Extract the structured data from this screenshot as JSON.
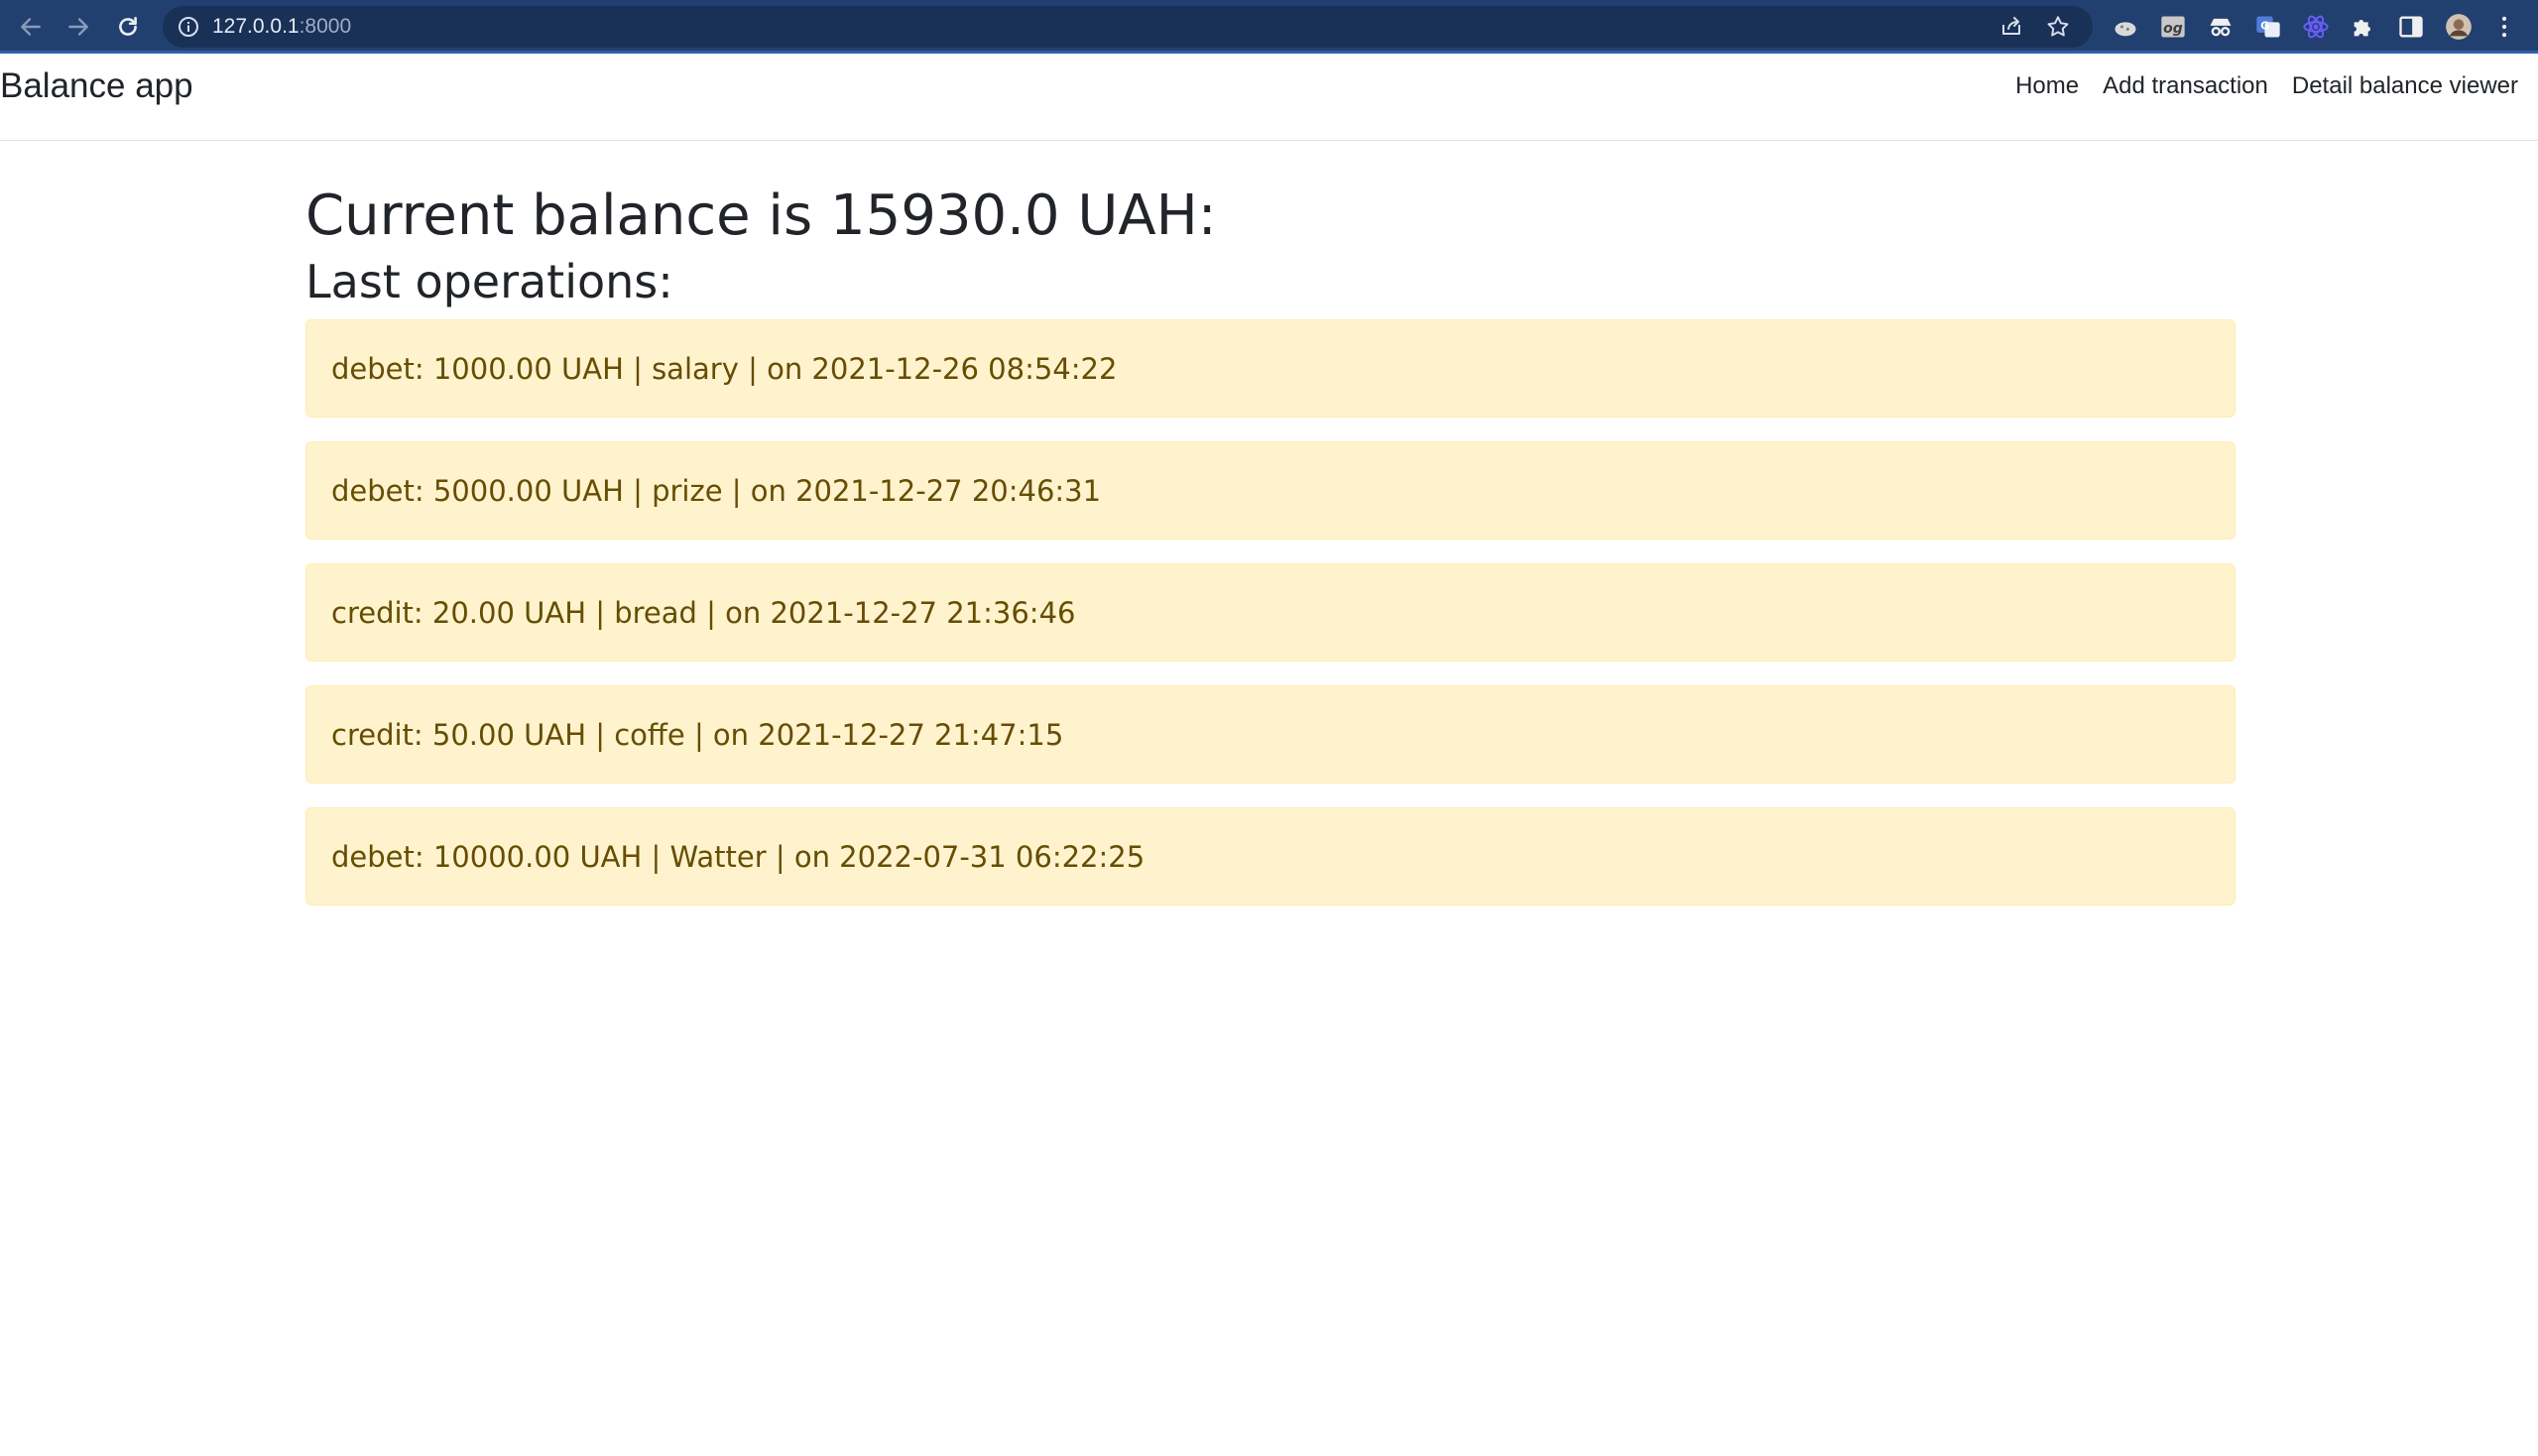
{
  "browser": {
    "url_host": "127.0.0.1",
    "url_port": ":8000"
  },
  "navbar": {
    "brand": "Balance app",
    "links": [
      {
        "label": "Home"
      },
      {
        "label": "Add transaction"
      },
      {
        "label": "Detail balance viewer"
      }
    ]
  },
  "main": {
    "balance_heading": "Current balance is 15930.0 UAH:",
    "operations_heading": "Last operations:",
    "operations": [
      {
        "text": "debet: 1000.00 UAH | salary | on 2021-12-26 08:54:22"
      },
      {
        "text": "debet: 5000.00 UAH | prize | on 2021-12-27 20:46:31"
      },
      {
        "text": "credit: 20.00 UAH | bread | on 2021-12-27 21:36:46"
      },
      {
        "text": "credit: 50.00 UAH | coffe | on 2021-12-27 21:47:15"
      },
      {
        "text": "debet: 10000.00 UAH | Watter | on 2022-07-31 06:22:25"
      }
    ]
  },
  "colors": {
    "browser_bar": "#22406f",
    "alert_background": "#fff3cd",
    "alert_text": "#664d03"
  }
}
